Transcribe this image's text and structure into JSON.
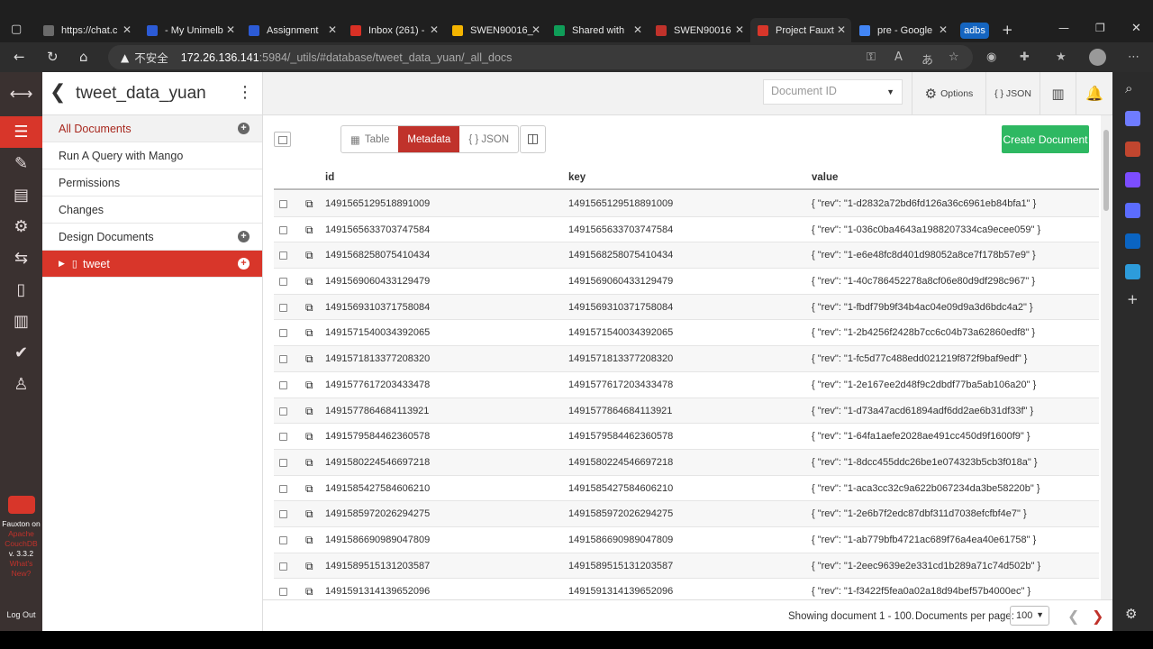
{
  "browser": {
    "tabs": [
      {
        "label": "https://chat.c",
        "color": "#6b6b6b"
      },
      {
        "label": "- My Unimelb",
        "color": "#2c5bd6"
      },
      {
        "label": "Assignment",
        "color": "#2c5bd6"
      },
      {
        "label": "Inbox (261) -",
        "color": "#d93025"
      },
      {
        "label": "SWEN90016_",
        "color": "#f4b400"
      },
      {
        "label": "Shared with",
        "color": "#0f9d58"
      },
      {
        "label": "SWEN90016",
        "color": "#c0322b"
      },
      {
        "label": "Project Fauxt",
        "color": "#d8362a"
      },
      {
        "label": "pre - Google",
        "color": "#4285f4"
      }
    ],
    "profile_badge": "adbs",
    "url_warning": "不安全",
    "url_host": "172.26.136.141",
    "url_path": ":5984/_utils/#database/tweet_data_yuan/_all_docs"
  },
  "sidebar": {
    "db_name": "tweet_data_yuan",
    "items": [
      {
        "label": "All Documents"
      },
      {
        "label": "Run A Query with Mango"
      },
      {
        "label": "Permissions"
      },
      {
        "label": "Changes"
      },
      {
        "label": "Design Documents"
      },
      {
        "label": "tweet"
      }
    ]
  },
  "rail": {
    "fauxton_label": "Fauxton on",
    "apache_label": "Apache CouchDB",
    "version": "v. 3.3.2",
    "whats_new": "What's New?",
    "logout": "Log Out"
  },
  "topbar": {
    "doc_id_placeholder": "Document ID",
    "options_label": "Options",
    "json_label": "{ } JSON"
  },
  "toolbar": {
    "table_label": "Table",
    "metadata_label": "Metadata",
    "json_label": "{ } JSON",
    "create_label": "Create Document"
  },
  "table": {
    "headers": [
      "id",
      "key",
      "value"
    ],
    "rows": [
      {
        "id": "1491565129518891009",
        "key": "1491565129518891009",
        "value": "{ \"rev\": \"1-d2832a72bd6fd126a36c6961eb84bfa1\" }"
      },
      {
        "id": "1491565633703747584",
        "key": "1491565633703747584",
        "value": "{ \"rev\": \"1-036c0ba4643a1988207334ca9ecee059\" }"
      },
      {
        "id": "1491568258075410434",
        "key": "1491568258075410434",
        "value": "{ \"rev\": \"1-e6e48fc8d401d98052a8ce7f178b57e9\" }"
      },
      {
        "id": "1491569060433129479",
        "key": "1491569060433129479",
        "value": "{ \"rev\": \"1-40c786452278a8cf06e80d9df298c967\" }"
      },
      {
        "id": "1491569310371758084",
        "key": "1491569310371758084",
        "value": "{ \"rev\": \"1-fbdf79b9f34b4ac04e09d9a3d6bdc4a2\" }"
      },
      {
        "id": "1491571540034392065",
        "key": "1491571540034392065",
        "value": "{ \"rev\": \"1-2b4256f2428b7cc6c04b73a62860edf8\" }"
      },
      {
        "id": "1491571813377208320",
        "key": "1491571813377208320",
        "value": "{ \"rev\": \"1-fc5d77c488edd021219f872f9baf9edf\" }"
      },
      {
        "id": "1491577617203433478",
        "key": "1491577617203433478",
        "value": "{ \"rev\": \"1-2e167ee2d48f9c2dbdf77ba5ab106a20\" }"
      },
      {
        "id": "1491577864684113921",
        "key": "1491577864684113921",
        "value": "{ \"rev\": \"1-d73a47acd61894adf6dd2ae6b31df33f\" }"
      },
      {
        "id": "1491579584462360578",
        "key": "1491579584462360578",
        "value": "{ \"rev\": \"1-64fa1aefe2028ae491cc450d9f1600f9\" }"
      },
      {
        "id": "1491580224546697218",
        "key": "1491580224546697218",
        "value": "{ \"rev\": \"1-8dcc455ddc26be1e074323b5cb3f018a\" }"
      },
      {
        "id": "1491585427584606210",
        "key": "1491585427584606210",
        "value": "{ \"rev\": \"1-aca3cc32c9a622b067234da3be58220b\" }"
      },
      {
        "id": "1491585972026294275",
        "key": "1491585972026294275",
        "value": "{ \"rev\": \"1-2e6b7f2edc87dbf311d7038efcfbf4e7\" }"
      },
      {
        "id": "1491586690989047809",
        "key": "1491586690989047809",
        "value": "{ \"rev\": \"1-ab779bfb4721ac689f76a4ea40e61758\" }"
      },
      {
        "id": "1491589515131203587",
        "key": "1491589515131203587",
        "value": "{ \"rev\": \"1-2eec9639e2e331cd1b289a71c74d502b\" }"
      },
      {
        "id": "1491591314139652096",
        "key": "1491591314139652096",
        "value": "{ \"rev\": \"1-f3422f5fea0a02a18d94bef57b4000ec\" }"
      }
    ]
  },
  "footer": {
    "showing": "Showing document 1 - 100.",
    "per_page_label": "Documents per page:",
    "per_page_value": "100"
  }
}
